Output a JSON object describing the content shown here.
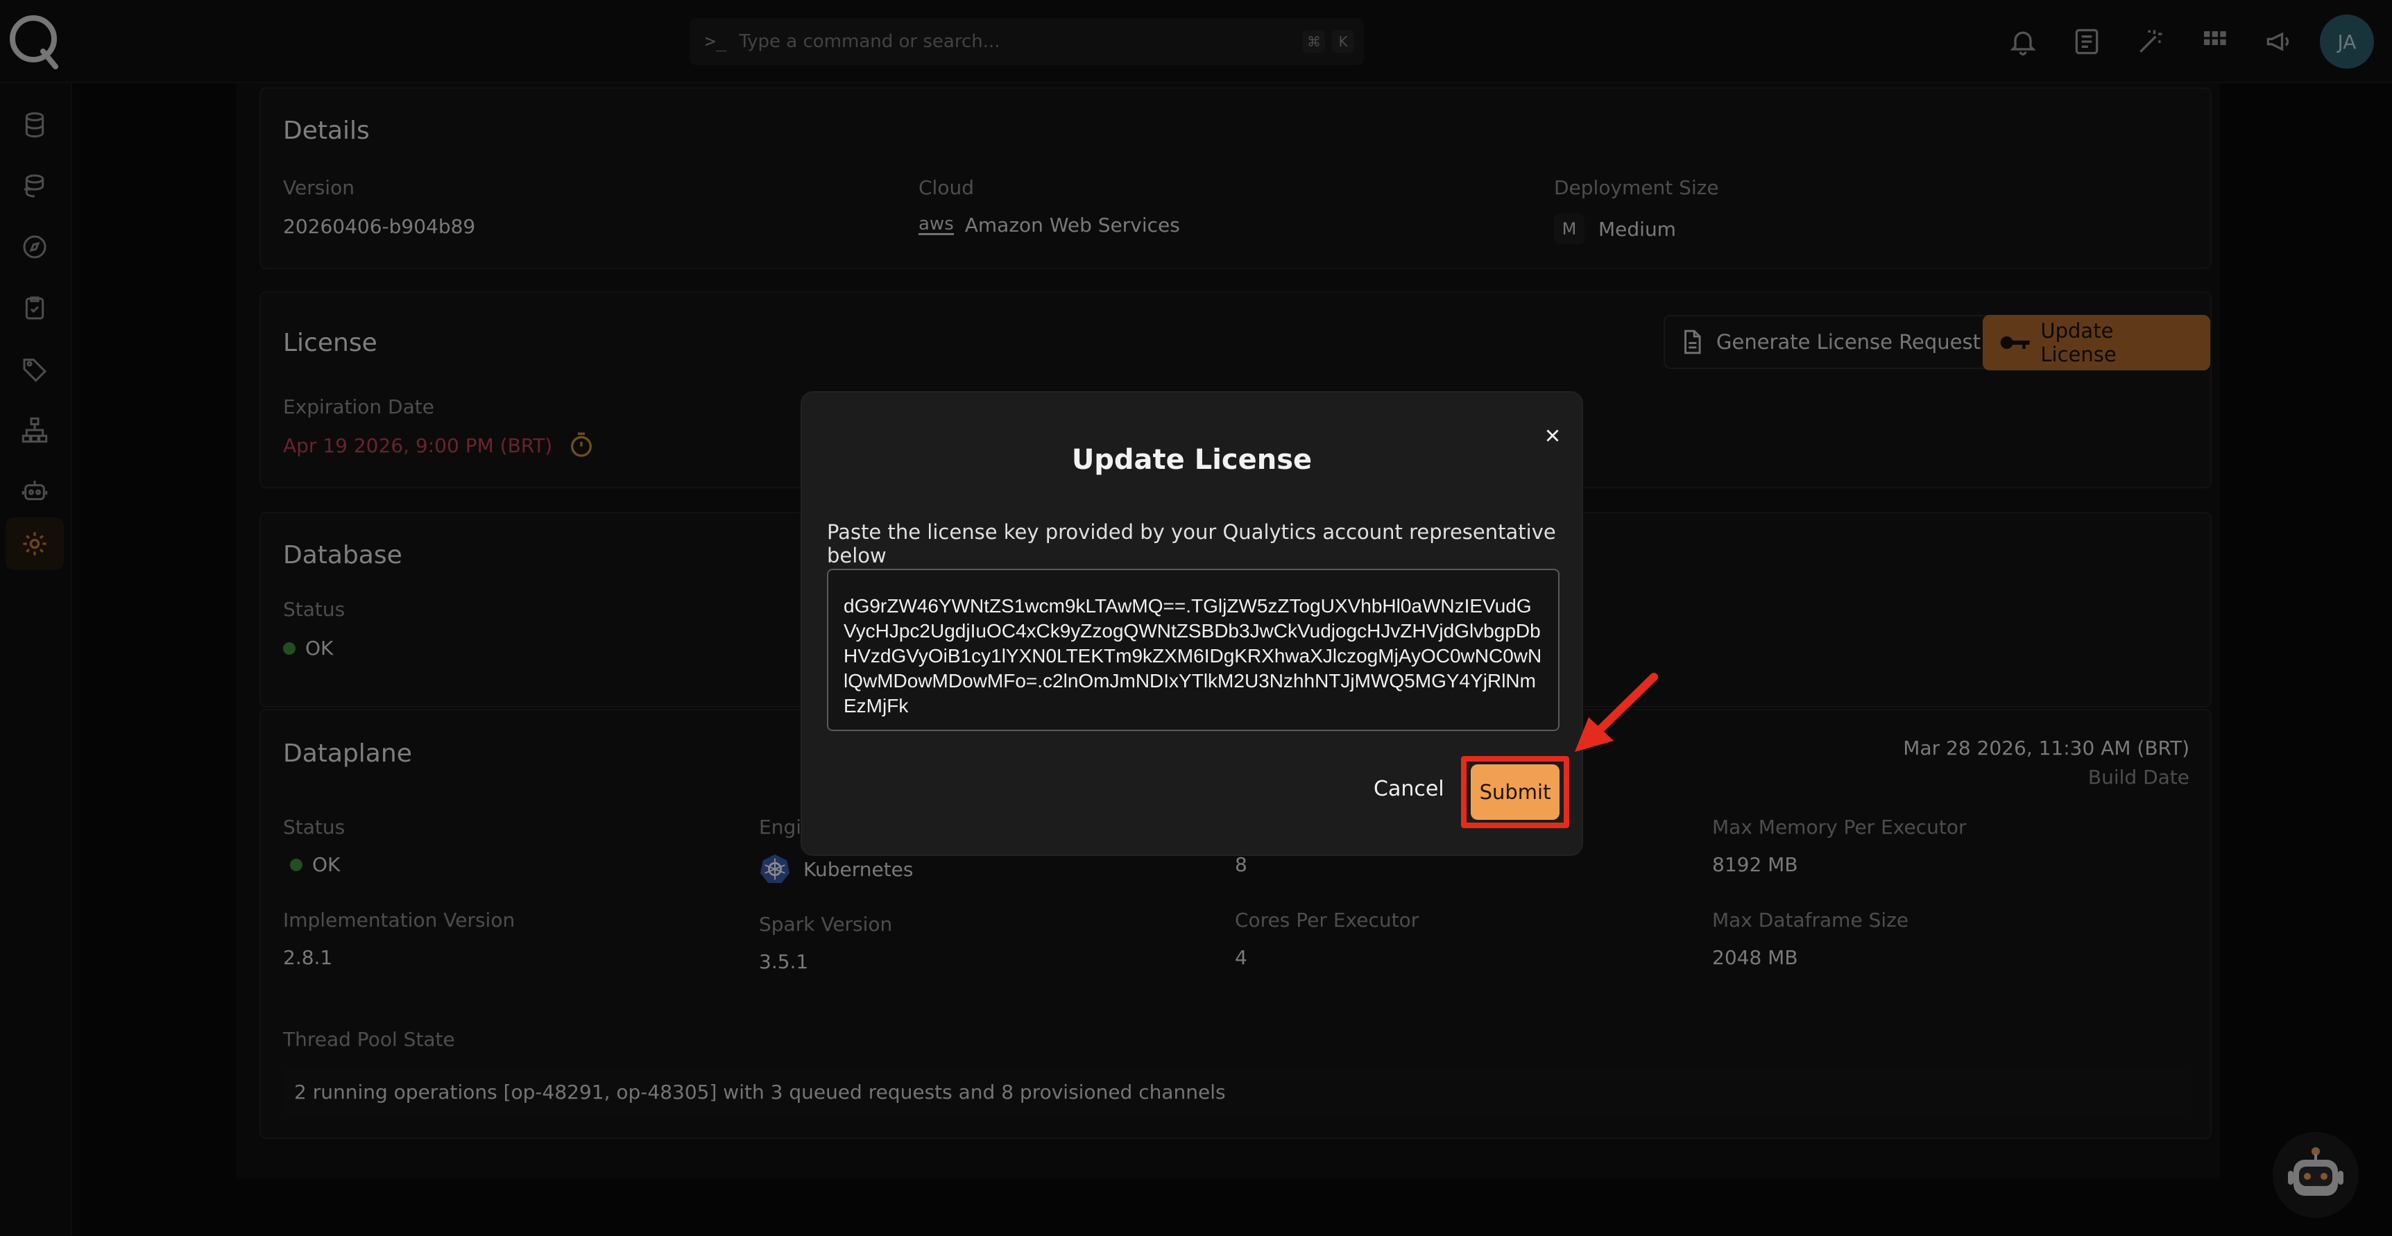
{
  "search": {
    "placeholder": "Type a command or search...",
    "kbd_cmd": "⌘",
    "kbd_k": "K"
  },
  "user": {
    "initials": "JA"
  },
  "details": {
    "title": "Details",
    "version_label": "Version",
    "version_value": "20260406-b904b89",
    "cloud_label": "Cloud",
    "cloud_value": "Amazon Web Services",
    "cloud_logo": "aws",
    "size_label": "Deployment Size",
    "size_value": "Medium",
    "size_icon": "M"
  },
  "license": {
    "title": "License",
    "expiration_label": "Expiration Date",
    "expiration_value": "Apr 19 2026, 9:00 PM (BRT)",
    "generate_button": "Generate License Request",
    "update_button": "Update License"
  },
  "database": {
    "title": "Database",
    "status_label": "Status",
    "status_value": "OK"
  },
  "dataplane": {
    "title": "Dataplane",
    "build_date": "Mar 28 2026, 11:30 AM (BRT)",
    "build_date_label": "Build Date",
    "status_label": "Status",
    "status_value": "OK",
    "engine_label": "Engine",
    "engine_value": "Kubernetes",
    "executors_value": "8",
    "max_memory_label": "Max Memory Per Executor",
    "max_memory_value": "8192 MB",
    "impl_version_label": "Implementation Version",
    "impl_version_value": "2.8.1",
    "spark_label": "Spark Version",
    "spark_value": "3.5.1",
    "cores_label": "Cores Per Executor",
    "cores_value": "4",
    "max_df_label": "Max Dataframe Size",
    "max_df_value": "2048 MB",
    "thread_label": "Thread Pool State",
    "thread_value": "2 running operations [op-48291, op-48305] with 3 queued requests and 8 provisioned channels"
  },
  "modal": {
    "title": "Update License",
    "description": "Paste the license key provided by your Qualytics account representative below",
    "license_key": "dG9rZW46YWNtZS1wcm9kLTAwMQ==.TGljZW5zZTogUXVhbHl0aWNzIEVudGVycHJpc2UgdjIuOC4xCk9yZzogQWNtZSBDb3JwCkVudjogcHJvZHVjdGlvbgpDbHVzdGVyOiB1cy1lYXN0LTEKTm9kZXM6IDgKRXhwaXJlczogMjAyOC0wNC0wNlQwMDowMDowMFo=.c2lnOmJmNDIxYTlkM2U3NzhhNTJjMWQ5MGY4YjRlNmEzMjFk",
    "cancel": "Cancel",
    "submit": "Submit"
  },
  "colors": {
    "accent": "#f0a050",
    "accent_dark": "#b06a2c",
    "expiry": "#c2414f",
    "ok": "#3f8f3f",
    "highlight": "#e52b1b"
  }
}
